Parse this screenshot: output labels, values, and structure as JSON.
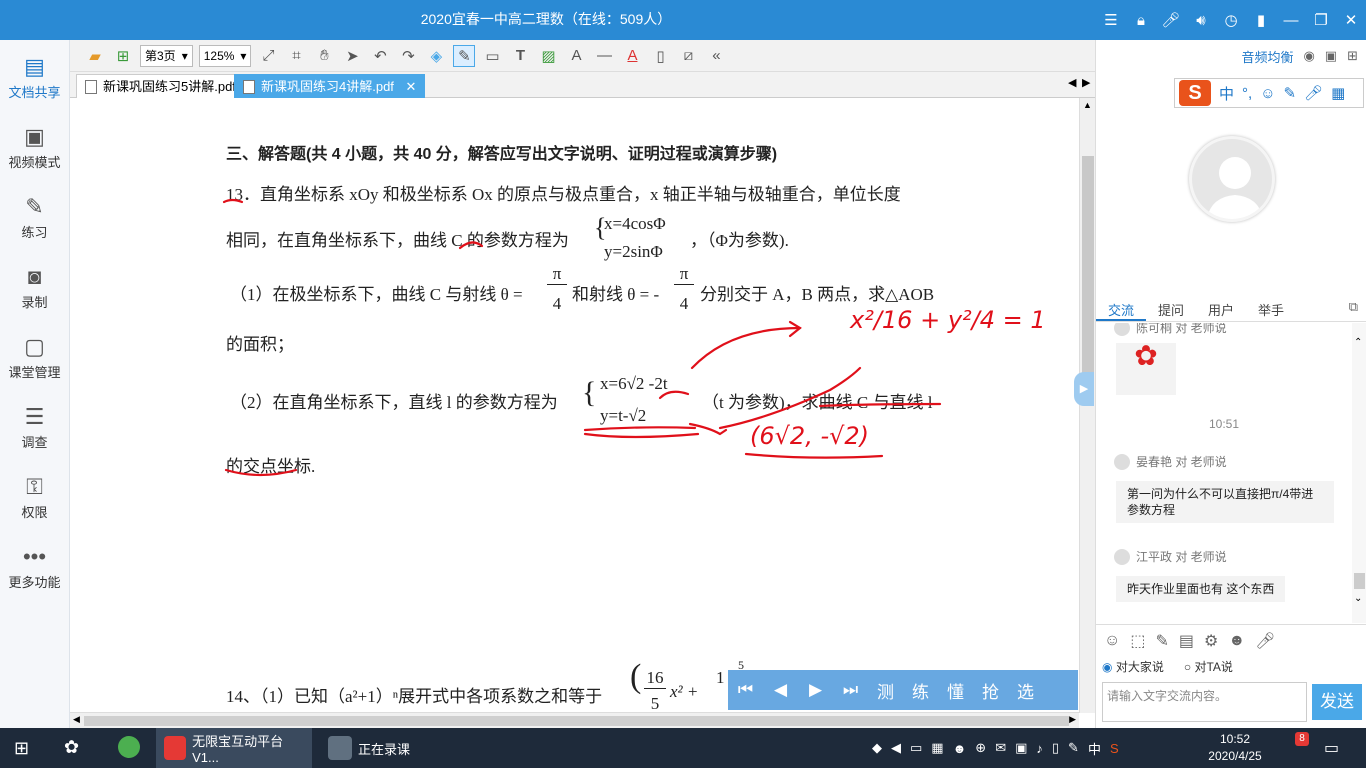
{
  "window": {
    "title": "2020宜春一中高二理数（在线：509人）"
  },
  "sidebar": {
    "items": [
      {
        "label": "文档共享"
      },
      {
        "label": "视频模式"
      },
      {
        "label": "练习"
      },
      {
        "label": "录制"
      },
      {
        "label": "课堂管理"
      },
      {
        "label": "调查"
      },
      {
        "label": "权限"
      },
      {
        "label": "更多功能"
      }
    ]
  },
  "toolbar": {
    "page": "第3页",
    "zoom": "125%"
  },
  "tabs": [
    {
      "label": "新课巩固练习5讲解.pdf"
    },
    {
      "label": "新课巩固练习4讲解.pdf"
    }
  ],
  "document": {
    "heading": "三、解答题(共 4 小题，共 40 分，解答应写出文字说明、证明过程或演算步骤)",
    "q13_line1": "13．直角坐标系 xOy 和极坐标系 Ox 的原点与极点重合，x 轴正半轴与极轴重合，单位长度",
    "q13_line2a": "相同，在直角坐标系下，曲线 C 的参数方程为",
    "q13_eq1": "x=4cosΦ",
    "q13_eq2": "y=2sinΦ",
    "q13_line2b": "，（Φ为参数).",
    "p1_a": "（1）在极坐标系下，曲线 C 与射线 θ =",
    "p1_frac1_num": "π",
    "p1_frac1_den": "4",
    "p1_b": "和射线 θ = -",
    "p1_frac2_num": "π",
    "p1_frac2_den": "4",
    "p1_c": "分别交于 A，B 两点，求△AOB",
    "p1_d": "的面积；",
    "p2_a": "（2）在直角坐标系下，直线 l 的参数方程为",
    "p2_eq1": "x=6√2 -2t",
    "p2_eq2": "y=t-√2",
    "p2_b": "（t 为参数)，求曲线 C 与直线 l",
    "p2_c": "的交点坐标.",
    "q14": "14、（1）已知（a²+1）ⁿ展开式中各项系数之和等于",
    "q14_frac": "16",
    "q14_den": "5",
    "q14_x": "x²  +",
    "q14_one": "1",
    "q14_exp": "5"
  },
  "annotations": {
    "ellipse": "x²/16 + y²/4 = 1",
    "answer": "(6√2, -√2)"
  },
  "player": {
    "controls": [
      "测",
      "练",
      "懂",
      "抢",
      "选"
    ]
  },
  "right_panel": {
    "audio_label": "音频均衡",
    "ime_label": "中",
    "chat_tabs": [
      "交流",
      "提问",
      "用户",
      "举手"
    ],
    "messages": [
      {
        "sender": "陈可桐 对 老师说",
        "type": "flower"
      },
      {
        "time": "10:51"
      },
      {
        "sender": "晏春艳 对 老师说",
        "text": "第一问为什么不可以直接把π/4带进参数方程"
      },
      {
        "sender": "江平政 对 老师说",
        "text": "昨天作业里面也有  这个东西"
      }
    ],
    "radio_all": "对大家说",
    "radio_ta": "对TA说",
    "input_placeholder": "请输入文字交流内容。",
    "send": "发送"
  },
  "taskbar": {
    "apps": [
      {
        "label": "无限宝互动平台 V1..."
      },
      {
        "label": "正在录课"
      }
    ],
    "tray_ime": "中",
    "time": "10:52",
    "date": "2020/4/25",
    "notification_count": "8"
  }
}
